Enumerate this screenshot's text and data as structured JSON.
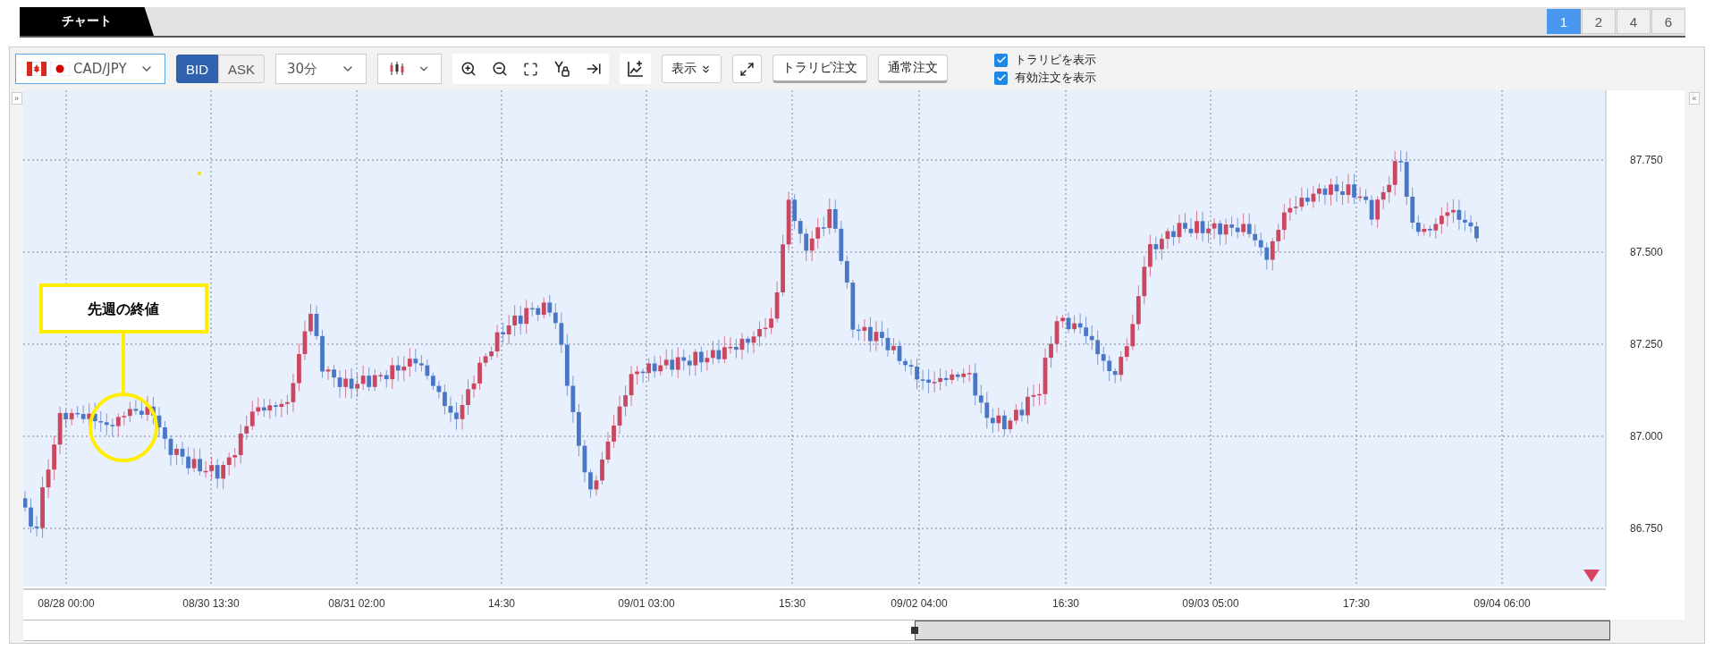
{
  "tab": {
    "label": "チャート"
  },
  "layout_buttons": [
    {
      "label": "1",
      "selected": true
    },
    {
      "label": "2",
      "selected": false
    },
    {
      "label": "4",
      "selected": false
    },
    {
      "label": "6",
      "selected": false
    }
  ],
  "toolbar": {
    "symbol": "CAD/JPY",
    "price_side": [
      {
        "label": "BID",
        "selected": true
      },
      {
        "label": "ASK",
        "selected": false
      }
    ],
    "timeframe": "30分",
    "display_menu": "表示",
    "order_buttons": [
      "トラリピ注文",
      "通常注文"
    ],
    "checkboxes": [
      {
        "label": "トラリピを表示",
        "checked": true
      },
      {
        "label": "有効注文を表示",
        "checked": true
      }
    ]
  },
  "chart": {
    "collapse_left": "»",
    "collapse_right": "«",
    "callout": "先週の終値",
    "y_labels": [
      "87.750",
      "87.500",
      "87.250",
      "87.000",
      "86.750"
    ],
    "x_labels": [
      "08/28 00:00",
      "08/30 13:30",
      "08/31 02:00",
      "14:30",
      "09/01 03:00",
      "15:30",
      "09/02 04:00",
      "16:30",
      "09/03 05:00",
      "17:30",
      "09/04 06:00"
    ]
  }
}
